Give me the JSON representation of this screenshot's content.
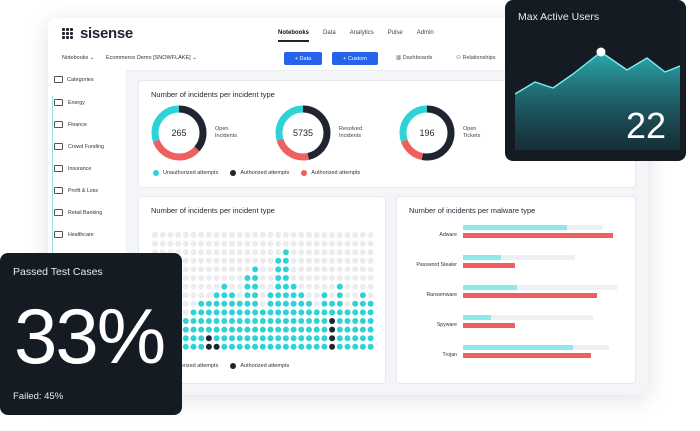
{
  "brand": {
    "name": "sisense"
  },
  "topnav": [
    {
      "label": "Notebooks",
      "active": true
    },
    {
      "label": "Data",
      "active": false
    },
    {
      "label": "Analytics",
      "active": false
    },
    {
      "label": "Pulse",
      "active": false
    },
    {
      "label": "Admin",
      "active": false
    }
  ],
  "toolbar": {
    "notebooks_label": "Notebooks",
    "datasource_label": "Ecommerce Demo [SNOWFLAKE]",
    "add_data_label": "+ Data",
    "add_custom_label": "+ Custom",
    "dashboards_label": "Dashboards",
    "relationships_label": "Relationships"
  },
  "sidebar": {
    "header": "Categories",
    "items": [
      "Energy",
      "Finance",
      "Crowd Funding",
      "Insurance",
      "Profit & Loss",
      "Retail Banking",
      "Healthcare"
    ]
  },
  "donut_card": {
    "title": "Number of incidents per incident type",
    "donuts": [
      {
        "value": "265",
        "label1": "Open",
        "label2": "Incidents"
      },
      {
        "value": "5735",
        "label1": "Resolved",
        "label2": "Incidents"
      },
      {
        "value": "196",
        "label1": "Open",
        "label2": "Tickets"
      }
    ],
    "legend": [
      "Unauthorized attempts",
      "Authorized attempts",
      "Authorized attempts"
    ]
  },
  "dot_card": {
    "title": "Number of incidents per incident type",
    "legend": [
      "Unauthorized attempts",
      "Authorized attempts"
    ]
  },
  "malware_card": {
    "title": "Number of incidents per malware type",
    "categories": [
      "Adware",
      "Password Stealer",
      "Ransomware",
      "Spyware",
      "Trojan"
    ]
  },
  "max_active_users": {
    "title": "Max Active Users",
    "value": "22"
  },
  "passed_tests": {
    "title": "Passed Test Cases",
    "value": "33%",
    "failed": "Failed: 45%"
  },
  "colors": {
    "teal": "#2fd3d6",
    "red": "#ef5f5f",
    "dark": "#151b23",
    "blue": "#2563eb"
  }
}
